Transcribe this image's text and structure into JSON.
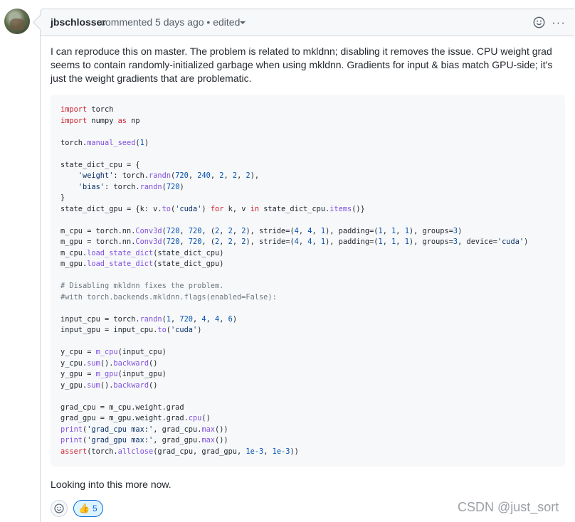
{
  "comment": {
    "author": "jbschlosser",
    "meta": "commented 5 days ago • edited",
    "body": "I can reproduce this on master. The problem is related to mkldnn; disabling it removes the issue. CPU weight grad seems to contain randomly-initialized garbage when using mkldnn. Gradients for input & bias match GPU-side; it's just the weight gradients that are problematic.",
    "footer": "Looking into this more now.",
    "reactions": [
      {
        "emoji": "👍",
        "count": "5"
      }
    ],
    "icons": {
      "add_reaction": "smiley-icon",
      "more": "kebab-horizontal-icon",
      "caret": "caret-down-icon"
    },
    "more_label": "···"
  },
  "code_lines": [
    [
      [
        "kw",
        "import"
      ],
      [
        "t",
        " torch"
      ]
    ],
    [
      [
        "kw",
        "import"
      ],
      [
        "t",
        " numpy "
      ],
      [
        "kw",
        "as"
      ],
      [
        "t",
        " np"
      ]
    ],
    [],
    [
      [
        "t",
        "torch."
      ],
      [
        "fn",
        "manual_seed"
      ],
      [
        "t",
        "("
      ],
      [
        "num",
        "1"
      ],
      [
        "t",
        ")"
      ]
    ],
    [],
    [
      [
        "t",
        "state_dict_cpu = {"
      ]
    ],
    [
      [
        "t",
        "    "
      ],
      [
        "str",
        "'weight'"
      ],
      [
        "t",
        ": torch."
      ],
      [
        "fn",
        "randn"
      ],
      [
        "t",
        "("
      ],
      [
        "num",
        "720"
      ],
      [
        "t",
        ", "
      ],
      [
        "num",
        "240"
      ],
      [
        "t",
        ", "
      ],
      [
        "num",
        "2"
      ],
      [
        "t",
        ", "
      ],
      [
        "num",
        "2"
      ],
      [
        "t",
        ", "
      ],
      [
        "num",
        "2"
      ],
      [
        "t",
        "),"
      ]
    ],
    [
      [
        "t",
        "    "
      ],
      [
        "str",
        "'bias'"
      ],
      [
        "t",
        ": torch."
      ],
      [
        "fn",
        "randn"
      ],
      [
        "t",
        "("
      ],
      [
        "num",
        "720"
      ],
      [
        "t",
        ")"
      ]
    ],
    [
      [
        "t",
        "}"
      ]
    ],
    [
      [
        "t",
        "state_dict_gpu = {k: v."
      ],
      [
        "fn",
        "to"
      ],
      [
        "t",
        "("
      ],
      [
        "str",
        "'cuda'"
      ],
      [
        "t",
        ") "
      ],
      [
        "kw",
        "for"
      ],
      [
        "t",
        " k, v "
      ],
      [
        "kw",
        "in"
      ],
      [
        "t",
        " state_dict_cpu."
      ],
      [
        "fn",
        "items"
      ],
      [
        "t",
        "()}"
      ]
    ],
    [],
    [
      [
        "t",
        "m_cpu = torch.nn."
      ],
      [
        "fn",
        "Conv3d"
      ],
      [
        "t",
        "("
      ],
      [
        "num",
        "720"
      ],
      [
        "t",
        ", "
      ],
      [
        "num",
        "720"
      ],
      [
        "t",
        ", ("
      ],
      [
        "num",
        "2"
      ],
      [
        "t",
        ", "
      ],
      [
        "num",
        "2"
      ],
      [
        "t",
        ", "
      ],
      [
        "num",
        "2"
      ],
      [
        "t",
        "), stride=("
      ],
      [
        "num",
        "4"
      ],
      [
        "t",
        ", "
      ],
      [
        "num",
        "4"
      ],
      [
        "t",
        ", "
      ],
      [
        "num",
        "1"
      ],
      [
        "t",
        "), padding=("
      ],
      [
        "num",
        "1"
      ],
      [
        "t",
        ", "
      ],
      [
        "num",
        "1"
      ],
      [
        "t",
        ", "
      ],
      [
        "num",
        "1"
      ],
      [
        "t",
        "), groups="
      ],
      [
        "num",
        "3"
      ],
      [
        "t",
        ")"
      ]
    ],
    [
      [
        "t",
        "m_gpu = torch.nn."
      ],
      [
        "fn",
        "Conv3d"
      ],
      [
        "t",
        "("
      ],
      [
        "num",
        "720"
      ],
      [
        "t",
        ", "
      ],
      [
        "num",
        "720"
      ],
      [
        "t",
        ", ("
      ],
      [
        "num",
        "2"
      ],
      [
        "t",
        ", "
      ],
      [
        "num",
        "2"
      ],
      [
        "t",
        ", "
      ],
      [
        "num",
        "2"
      ],
      [
        "t",
        "), stride=("
      ],
      [
        "num",
        "4"
      ],
      [
        "t",
        ", "
      ],
      [
        "num",
        "4"
      ],
      [
        "t",
        ", "
      ],
      [
        "num",
        "1"
      ],
      [
        "t",
        "), padding=("
      ],
      [
        "num",
        "1"
      ],
      [
        "t",
        ", "
      ],
      [
        "num",
        "1"
      ],
      [
        "t",
        ", "
      ],
      [
        "num",
        "1"
      ],
      [
        "t",
        "), groups="
      ],
      [
        "num",
        "3"
      ],
      [
        "t",
        ", device="
      ],
      [
        "str",
        "'cuda'"
      ],
      [
        "t",
        ")"
      ]
    ],
    [
      [
        "t",
        "m_cpu."
      ],
      [
        "fn",
        "load_state_dict"
      ],
      [
        "t",
        "(state_dict_cpu)"
      ]
    ],
    [
      [
        "t",
        "m_gpu."
      ],
      [
        "fn",
        "load_state_dict"
      ],
      [
        "t",
        "(state_dict_gpu)"
      ]
    ],
    [],
    [
      [
        "cm",
        "# Disabling mkldnn fixes the problem."
      ]
    ],
    [
      [
        "cm",
        "#with torch.backends.mkldnn.flags(enabled=False):"
      ]
    ],
    [],
    [
      [
        "t",
        "input_cpu = torch."
      ],
      [
        "fn",
        "randn"
      ],
      [
        "t",
        "("
      ],
      [
        "num",
        "1"
      ],
      [
        "t",
        ", "
      ],
      [
        "num",
        "720"
      ],
      [
        "t",
        ", "
      ],
      [
        "num",
        "4"
      ],
      [
        "t",
        ", "
      ],
      [
        "num",
        "4"
      ],
      [
        "t",
        ", "
      ],
      [
        "num",
        "6"
      ],
      [
        "t",
        ")"
      ]
    ],
    [
      [
        "t",
        "input_gpu = input_cpu."
      ],
      [
        "fn",
        "to"
      ],
      [
        "t",
        "("
      ],
      [
        "str",
        "'cuda'"
      ],
      [
        "t",
        ")"
      ]
    ],
    [],
    [
      [
        "t",
        "y_cpu = "
      ],
      [
        "fn",
        "m_cpu"
      ],
      [
        "t",
        "(input_cpu)"
      ]
    ],
    [
      [
        "t",
        "y_cpu."
      ],
      [
        "fn",
        "sum"
      ],
      [
        "t",
        "()."
      ],
      [
        "fn",
        "backward"
      ],
      [
        "t",
        "()"
      ]
    ],
    [
      [
        "t",
        "y_gpu = "
      ],
      [
        "fn",
        "m_gpu"
      ],
      [
        "t",
        "(input_gpu)"
      ]
    ],
    [
      [
        "t",
        "y_gpu."
      ],
      [
        "fn",
        "sum"
      ],
      [
        "t",
        "()."
      ],
      [
        "fn",
        "backward"
      ],
      [
        "t",
        "()"
      ]
    ],
    [],
    [
      [
        "t",
        "grad_cpu = m_cpu.weight.grad"
      ]
    ],
    [
      [
        "t",
        "grad_gpu = m_gpu.weight.grad."
      ],
      [
        "fn",
        "cpu"
      ],
      [
        "t",
        "()"
      ]
    ],
    [
      [
        "fn",
        "print"
      ],
      [
        "t",
        "("
      ],
      [
        "str",
        "'grad_cpu max:'"
      ],
      [
        "t",
        ", grad_cpu."
      ],
      [
        "fn",
        "max"
      ],
      [
        "t",
        "())"
      ]
    ],
    [
      [
        "fn",
        "print"
      ],
      [
        "t",
        "("
      ],
      [
        "str",
        "'grad_gpu max:'"
      ],
      [
        "t",
        ", grad_gpu."
      ],
      [
        "fn",
        "max"
      ],
      [
        "t",
        "())"
      ]
    ],
    [
      [
        "kw",
        "assert"
      ],
      [
        "t",
        "(torch."
      ],
      [
        "fn",
        "allclose"
      ],
      [
        "t",
        "(grad_cpu, grad_gpu, "
      ],
      [
        "num",
        "1e-3"
      ],
      [
        "t",
        ", "
      ],
      [
        "num",
        "1e-3"
      ],
      [
        "t",
        "))"
      ]
    ]
  ],
  "watermark": "CSDN @just_sort",
  "colors": {
    "keyword": "#cf222e",
    "function": "#8250df",
    "string": "#0a3069",
    "number": "#0550ae",
    "comment": "#6e7781",
    "reaction_border": "#0969da"
  }
}
